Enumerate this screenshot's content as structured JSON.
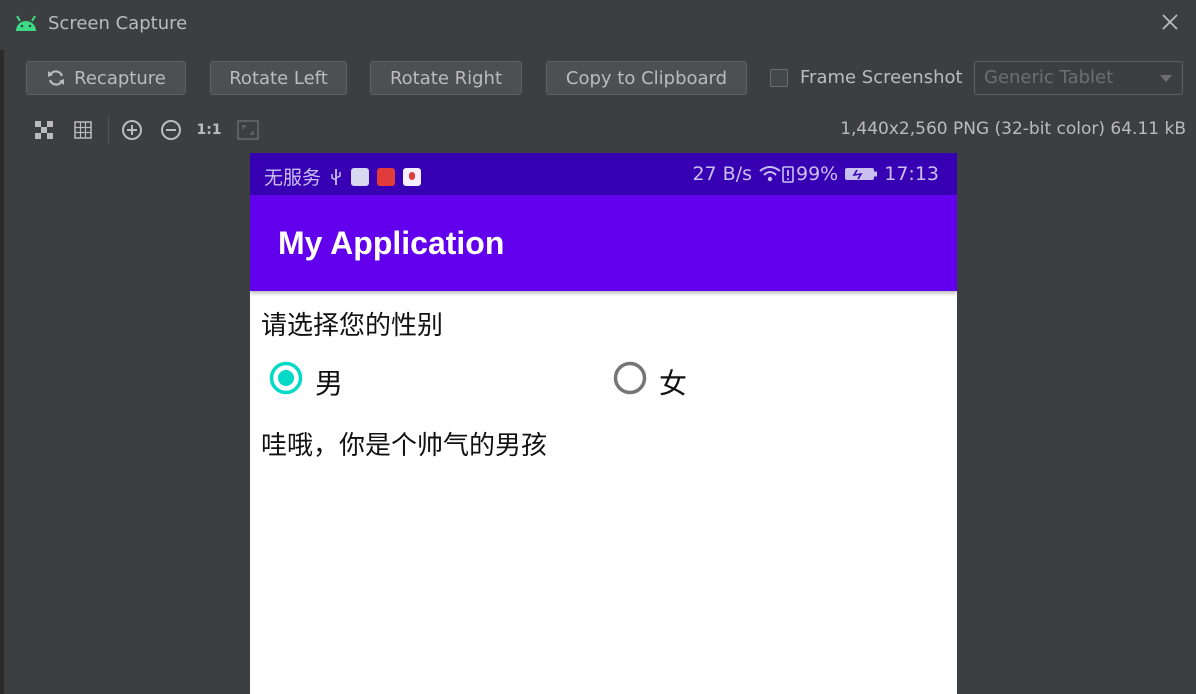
{
  "window": {
    "title": "Screen Capture"
  },
  "toolbar": {
    "recapture": "Recapture",
    "rotate_left": "Rotate Left",
    "rotate_right": "Rotate Right",
    "copy": "Copy to Clipboard",
    "frame_screenshot": "Frame Screenshot",
    "frame_checked": false,
    "device_select": "Generic Tablet"
  },
  "view_tools": {
    "actual_size": "1:1"
  },
  "image_info": "1,440x2,560 PNG (32-bit color) 64.11 kB",
  "phone": {
    "status_left": "无服务",
    "status_speed": "27 B/s",
    "status_battery": "99%",
    "status_time": "17:13",
    "app_title": "My Application",
    "prompt": "请选择您的性别",
    "options": [
      {
        "label": "男",
        "checked": true
      },
      {
        "label": "女",
        "checked": false
      }
    ],
    "result": "哇哦，你是个帅气的男孩",
    "accent": "#03dac5",
    "primary": "#6200ee",
    "primary_dark": "#3700b3"
  }
}
